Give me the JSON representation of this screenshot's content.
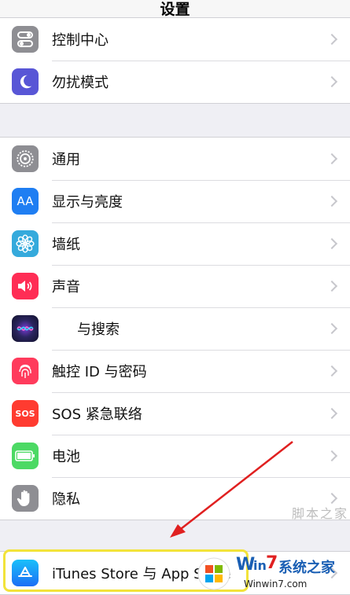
{
  "nav": {
    "title": "设置"
  },
  "group1": [
    {
      "label": "控制中心",
      "icon": "control-center-icon",
      "color": "#8e8e93"
    },
    {
      "label": "勿扰模式",
      "icon": "moon-icon",
      "color": "#5856d6"
    }
  ],
  "group2": [
    {
      "label": "通用",
      "icon": "gear-icon",
      "color": "#8e8e93"
    },
    {
      "label": "显示与亮度",
      "icon": "text-size-icon",
      "color": "#1f7ef2"
    },
    {
      "label": "墙纸",
      "icon": "flower-icon",
      "color": "#35aadc"
    },
    {
      "label": "声音",
      "icon": "speaker-icon",
      "color": "#ff2d55"
    },
    {
      "label": "与搜索",
      "icon": "siri-icon",
      "color": "#1c1c3c"
    },
    {
      "label": "触控 ID 与密码",
      "icon": "fingerprint-icon",
      "color": "#ff3b5c"
    },
    {
      "label": "SOS 紧急联络",
      "icon": "sos-icon",
      "color": "#ff3b30"
    },
    {
      "label": "电池",
      "icon": "battery-icon",
      "color": "#4cd964"
    },
    {
      "label": "隐私",
      "icon": "hand-icon",
      "color": "#8e8e93"
    }
  ],
  "group3": [
    {
      "label": "iTunes Store 与 App Store",
      "icon": "app-store-icon",
      "color": "#1d8cf5"
    }
  ],
  "icon_text": {
    "text_size": "AA",
    "sos": "SOS"
  },
  "watermark": {
    "brand_w": "W",
    "brand_in": "in",
    "brand_7": "7",
    "brand_cn": "系统之家",
    "url": "Winwin7.com"
  },
  "side_watermark": "脚本之家",
  "annotation": {
    "arrow_color": "#e02020",
    "highlight_color": "#f2e33a"
  }
}
